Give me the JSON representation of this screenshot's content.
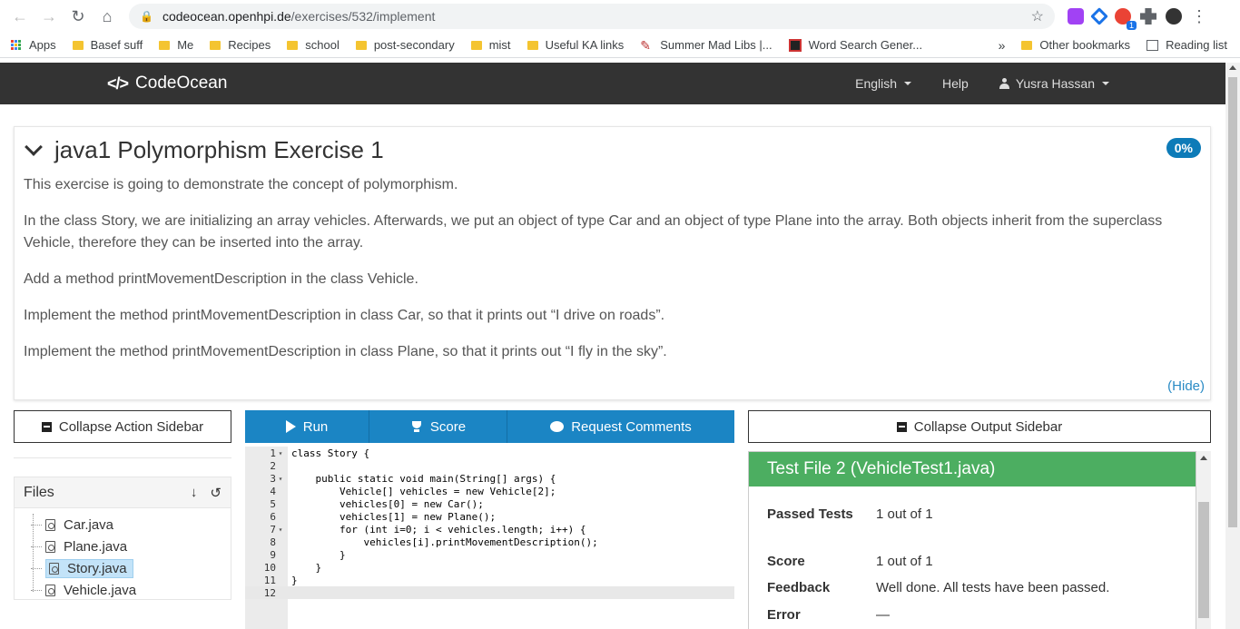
{
  "browser": {
    "url_host": "codeocean.openhpi.de",
    "url_path": "/exercises/532/implement",
    "ext_badge": "1",
    "bookmarks": [
      "Apps",
      "Basef suff",
      "Me",
      "Recipes",
      "school",
      "post-secondary",
      "mist",
      "Useful KA links",
      "Summer Mad Libs |...",
      "Word Search Gener..."
    ],
    "bookmarks_overflow": "»",
    "other_bookmarks": "Other bookmarks",
    "reading_list": "Reading list"
  },
  "navbar": {
    "brand_icon": "</>",
    "brand": "CodeOcean",
    "language": "English",
    "help": "Help",
    "user": "Yusra Hassan"
  },
  "exercise": {
    "title": "java1 Polymorphism Exercise 1",
    "progress": "0%",
    "paragraphs": [
      "This exercise is going to demonstrate the concept of polymorphism.",
      "In the class Story, we are initializing an array vehicles. Afterwards, we put an object of type Car and an object of type Plane into the array. Both objects inherit from the superclass Vehicle, therefore they can be inserted into the array.",
      "Add a method printMovementDescription in the class Vehicle.",
      "Implement the method printMovementDescription in class Car, so that it prints out “I drive on roads”.",
      "Implement the method printMovementDescription in class Plane, so that it prints out “I fly in the sky”."
    ],
    "hide": "(Hide)"
  },
  "actions": {
    "collapse_action_sidebar": "Collapse Action Sidebar",
    "run": "Run",
    "score": "Score",
    "request_comments": "Request Comments",
    "collapse_output_sidebar": "Collapse Output Sidebar"
  },
  "files": {
    "header": "Files",
    "items": [
      "Car.java",
      "Plane.java",
      "Story.java",
      "Vehicle.java"
    ],
    "selected": "Story.java"
  },
  "editor": {
    "lines": [
      {
        "n": "1",
        "fold": true,
        "text": "class Story {"
      },
      {
        "n": "2",
        "fold": false,
        "text": ""
      },
      {
        "n": "3",
        "fold": true,
        "text": "    public static void main(String[] args) {"
      },
      {
        "n": "4",
        "fold": false,
        "text": "        Vehicle[] vehicles = new Vehicle[2];"
      },
      {
        "n": "5",
        "fold": false,
        "text": "        vehicles[0] = new Car();"
      },
      {
        "n": "6",
        "fold": false,
        "text": "        vehicles[1] = new Plane();"
      },
      {
        "n": "7",
        "fold": true,
        "text": "        for (int i=0; i < vehicles.length; i++) {"
      },
      {
        "n": "8",
        "fold": false,
        "text": "            vehicles[i].printMovementDescription();"
      },
      {
        "n": "9",
        "fold": false,
        "text": "        }"
      },
      {
        "n": "10",
        "fold": false,
        "text": "    }"
      },
      {
        "n": "11",
        "fold": false,
        "text": "}"
      },
      {
        "n": "12",
        "fold": false,
        "text": ""
      }
    ]
  },
  "output": {
    "header": "Test File 2 (VehicleTest1.java)",
    "passed_tests_label": "Passed Tests",
    "passed_tests_value": "1 out of 1",
    "score_label": "Score",
    "score_value": "1 out of 1",
    "feedback_label": "Feedback",
    "feedback_value": "Well done. All tests have been passed.",
    "error_label": "Error",
    "error_value": "—"
  },
  "colors": {
    "navbar": "#333333",
    "action_blue": "#1b85c4",
    "success_green": "#4cae61",
    "badge_blue": "#0d7bb8"
  }
}
